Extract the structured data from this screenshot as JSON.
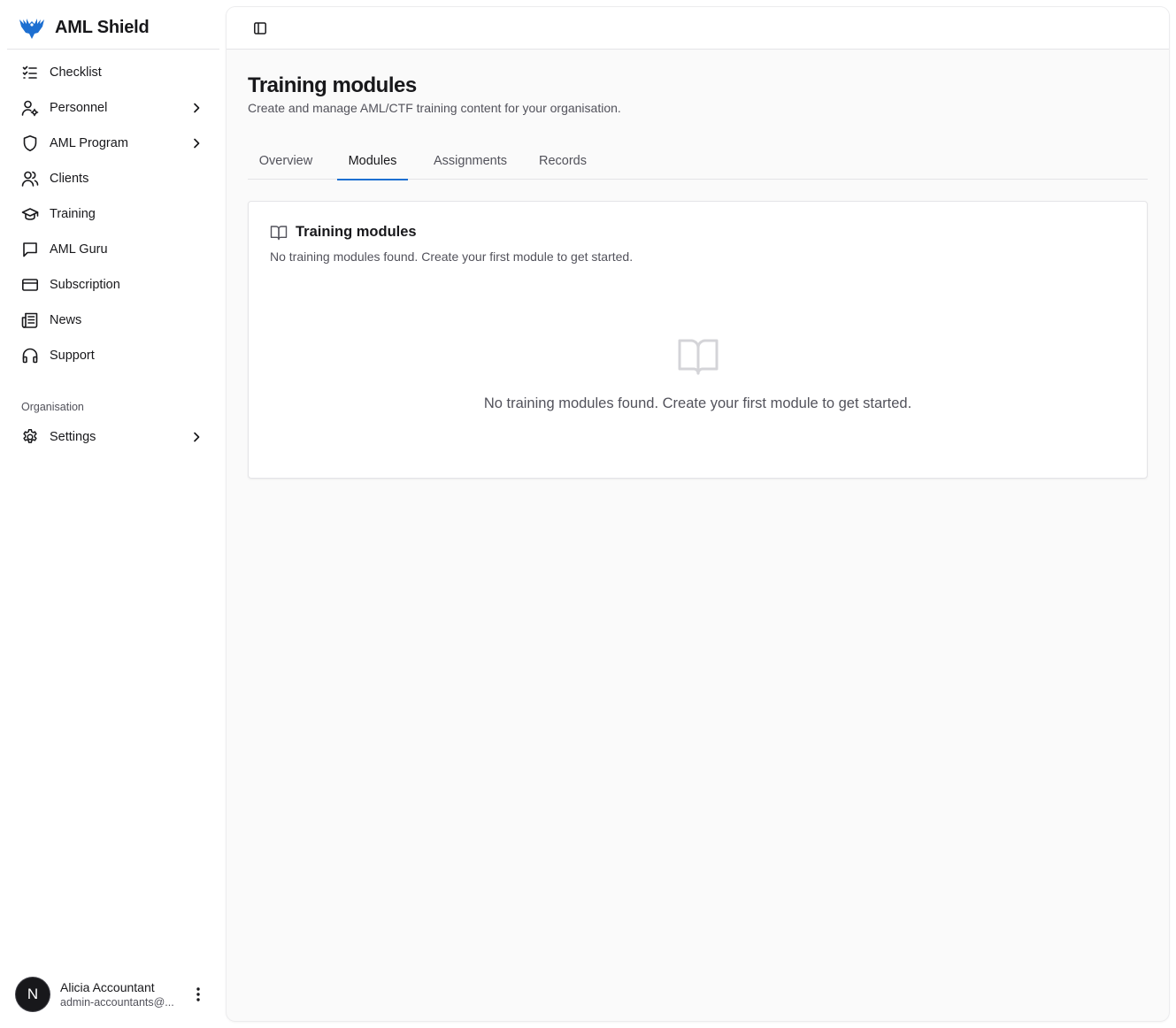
{
  "brand": {
    "name": "AML Shield",
    "logo_icon": "eagle-logo-icon",
    "logo_color": "#1d6fd1"
  },
  "sidebar": {
    "items": [
      {
        "label": "Checklist",
        "icon": "checklist-icon",
        "has_children": false
      },
      {
        "label": "Personnel",
        "icon": "user-cog-icon",
        "has_children": true
      },
      {
        "label": "AML Program",
        "icon": "shield-icon",
        "has_children": true
      },
      {
        "label": "Clients",
        "icon": "users-icon",
        "has_children": false
      },
      {
        "label": "Training",
        "icon": "graduation-cap-icon",
        "has_children": false
      },
      {
        "label": "AML Guru",
        "icon": "message-square-icon",
        "has_children": false
      },
      {
        "label": "Subscription",
        "icon": "credit-card-icon",
        "has_children": false
      },
      {
        "label": "News",
        "icon": "newspaper-icon",
        "has_children": false
      },
      {
        "label": "Support",
        "icon": "headphones-icon",
        "has_children": false
      }
    ],
    "group_label": "Organisation",
    "org_items": [
      {
        "label": "Settings",
        "icon": "gear-icon",
        "has_children": true
      }
    ]
  },
  "user": {
    "initial": "N",
    "name": "Alicia Accountant",
    "email": "admin-accountants@..."
  },
  "page": {
    "title": "Training modules",
    "subtitle": "Create and manage AML/CTF training content for your organisation.",
    "tabs": [
      {
        "label": "Overview",
        "active": false
      },
      {
        "label": "Modules",
        "active": true
      },
      {
        "label": "Assignments",
        "active": false
      },
      {
        "label": "Records",
        "active": false
      }
    ]
  },
  "card": {
    "title": "Training modules",
    "description": "No training modules found. Create your first module to get started.",
    "empty_message": "No training modules found. Create your first module to get started."
  },
  "colors": {
    "accent": "#1d6fd1",
    "text": "#18181b",
    "muted": "#52525b",
    "border": "#e4e4e7"
  }
}
